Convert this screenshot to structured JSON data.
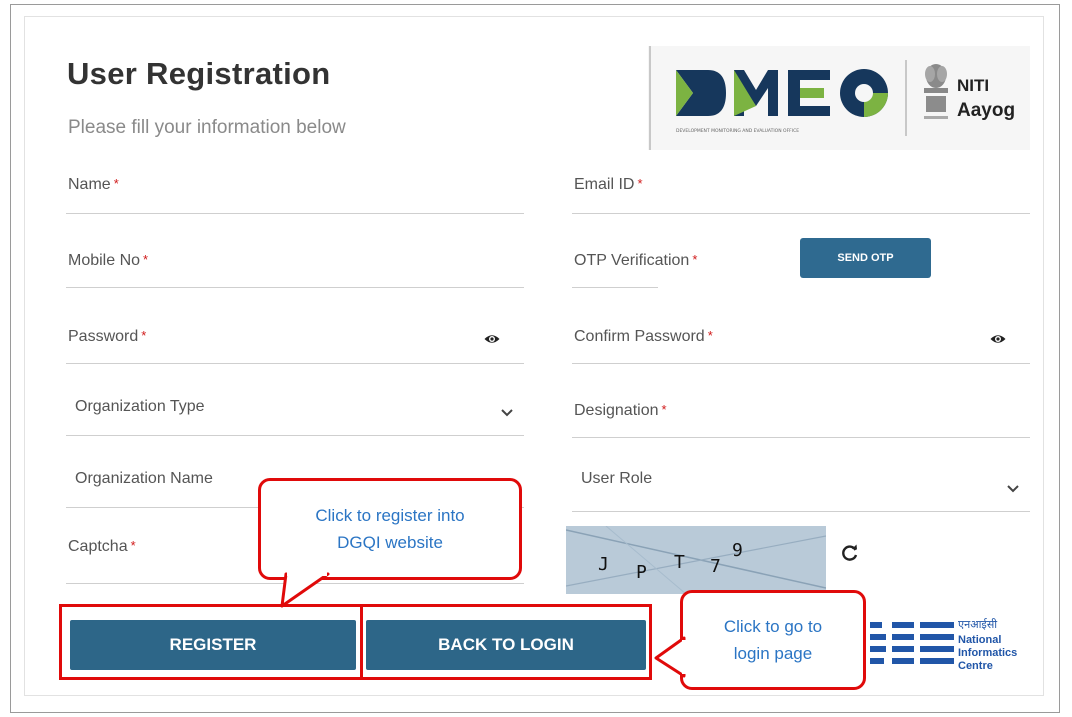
{
  "header": {
    "title": "User Registration",
    "subtitle": "Please fill your information below"
  },
  "logos": {
    "dmeo": {
      "name": "DMEO",
      "tagline": "DEVELOPMENT MONITORING AND EVALUATION OFFICE",
      "partner": "NITI Aayog",
      "partner_line1": "NITI",
      "partner_line2": "Aayog"
    },
    "nic": {
      "script": "एनआईसी",
      "line1": "National",
      "line2": "Informatics",
      "line3": "Centre"
    }
  },
  "form": {
    "name": {
      "label": "Name",
      "required_mark": "*",
      "value": ""
    },
    "email": {
      "label": "Email ID",
      "required_mark": "*",
      "value": ""
    },
    "mobile": {
      "label": "Mobile No",
      "required_mark": "*",
      "value": ""
    },
    "otp": {
      "label": "OTP Verification",
      "required_mark": "*",
      "value": ""
    },
    "send_otp_label": "SEND OTP",
    "password": {
      "label": "Password",
      "required_mark": "*",
      "value": ""
    },
    "confirm_password": {
      "label": "Confirm Password",
      "required_mark": "*",
      "value": ""
    },
    "organization_type": {
      "label": "Organization Type",
      "selected": ""
    },
    "designation": {
      "label": "Designation",
      "required_mark": "*",
      "value": ""
    },
    "organization_name": {
      "label": "Organization Name",
      "value": ""
    },
    "user_role": {
      "label": "User Role",
      "selected": ""
    },
    "captcha": {
      "label": "Captcha",
      "required_mark": "*",
      "value": "",
      "characters": [
        "J",
        "P",
        "T",
        "7",
        "9"
      ]
    }
  },
  "buttons": {
    "register": "REGISTER",
    "back_to_login": "BACK TO LOGIN"
  },
  "annotations": {
    "register_callout_line1": "Click to register into",
    "register_callout_line2": "DGQI website",
    "login_callout_line1": "Click to go to",
    "login_callout_line2": "login page"
  },
  "colors": {
    "primary_button": "#2d6688",
    "send_otp_button": "#2f6a90",
    "required_mark": "#d01818",
    "highlight": "#e00a0a",
    "callout_text": "#2b75c4"
  },
  "icons": [
    "eye-icon",
    "chevron-down-icon",
    "refresh-icon"
  ]
}
